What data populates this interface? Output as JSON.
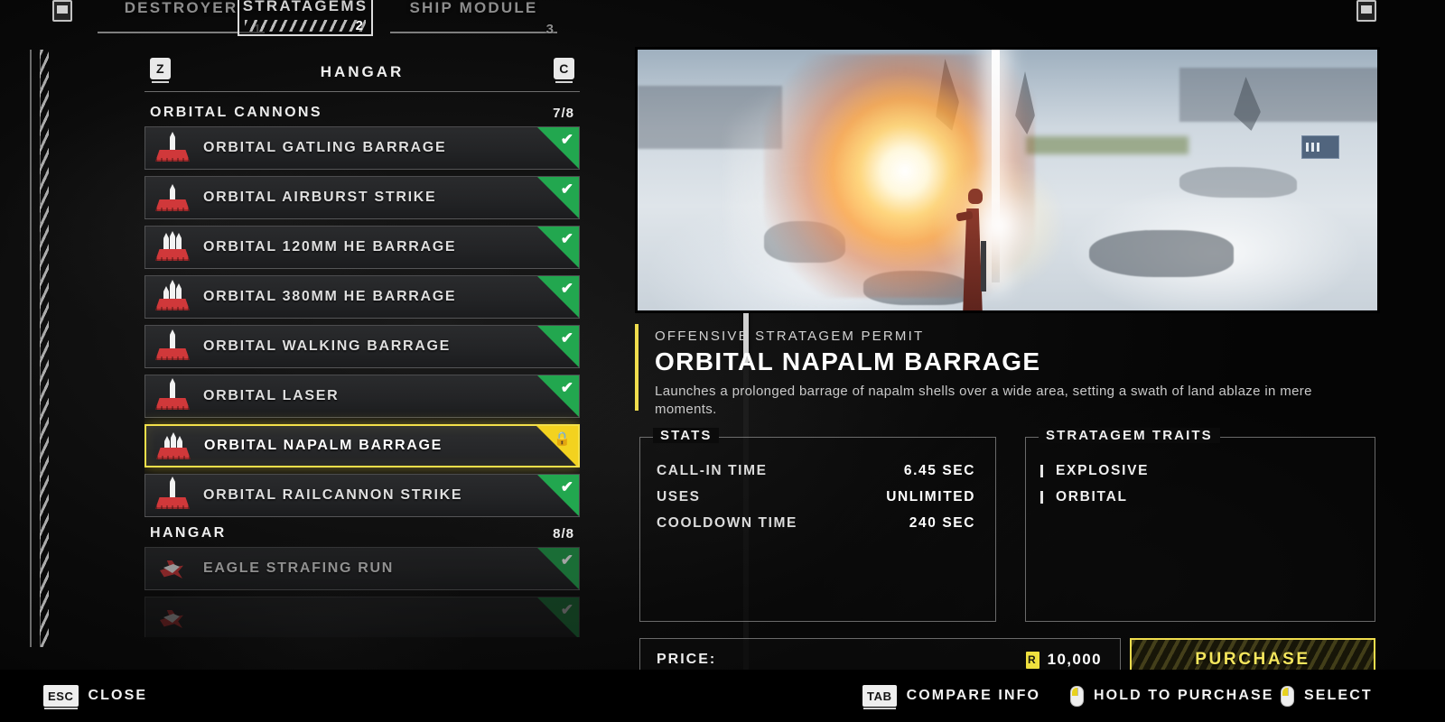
{
  "topbar": {
    "tabs": [
      {
        "label": "DESTROYER",
        "number": "1",
        "active": false
      },
      {
        "label": "STRATAGEMS",
        "number": "2",
        "active": true
      },
      {
        "label": "SHIP MODULE",
        "number": "3",
        "active": false
      }
    ]
  },
  "list": {
    "header_title": "HANGAR",
    "key_left": "Z",
    "key_right": "C",
    "groups": [
      {
        "name": "ORBITAL CANNONS",
        "count": "7/8",
        "items": [
          {
            "label": "ORBITAL GATLING BARRAGE",
            "state": "owned",
            "mark": "✔",
            "icon": "orbital-cannon-icon"
          },
          {
            "label": "ORBITAL AIRBURST STRIKE",
            "state": "owned",
            "mark": "✔",
            "icon": "orbital-cannon-icon"
          },
          {
            "label": "ORBITAL 120MM HE BARRAGE",
            "state": "owned",
            "mark": "✔",
            "icon": "orbital-cannon-icon"
          },
          {
            "label": "ORBITAL 380MM HE BARRAGE",
            "state": "owned",
            "mark": "✔",
            "icon": "orbital-cannon-icon"
          },
          {
            "label": "ORBITAL WALKING BARRAGE",
            "state": "owned",
            "mark": "✔",
            "icon": "orbital-cannon-icon"
          },
          {
            "label": "ORBITAL LASER",
            "state": "owned",
            "mark": "✔",
            "icon": "orbital-cannon-icon"
          },
          {
            "label": "ORBITAL NAPALM BARRAGE",
            "state": "locked-selected",
            "mark": "🔒",
            "icon": "orbital-cannon-icon"
          },
          {
            "label": "ORBITAL RAILCANNON STRIKE",
            "state": "owned",
            "mark": "✔",
            "icon": "orbital-cannon-icon"
          }
        ]
      },
      {
        "name": "HANGAR",
        "count": "8/8",
        "items": [
          {
            "label": "EAGLE STRAFING RUN",
            "state": "owned",
            "mark": "✔",
            "icon": "eagle-icon"
          }
        ]
      }
    ]
  },
  "detail": {
    "category": "OFFENSIVE STRATAGEM PERMIT",
    "name": "ORBITAL NAPALM BARRAGE",
    "description": "Launches a prolonged barrage of napalm shells over a wide area, setting a swath of land ablaze in mere moments.",
    "stats_title": "STATS",
    "stats": [
      {
        "key": "CALL-IN TIME",
        "value": "6.45 SEC"
      },
      {
        "key": "USES",
        "value": "UNLIMITED"
      },
      {
        "key": "COOLDOWN TIME",
        "value": "240 SEC"
      }
    ],
    "traits_title": "STRATAGEM TRAITS",
    "traits": [
      "EXPLOSIVE",
      "ORBITAL"
    ],
    "price_label": "PRICE:",
    "price_value": "10,000",
    "currency_symbol": "R",
    "purchase_label": "PURCHASE"
  },
  "bottombar": {
    "close_key": "ESC",
    "close_label": "CLOSE",
    "compare_key": "TAB",
    "compare_label": "COMPARE INFO",
    "hold_label": "HOLD TO PURCHASE",
    "select_label": "SELECT"
  },
  "colors": {
    "accent_yellow": "#f0dd4d",
    "owned_green": "#22a74f",
    "locked_yellow": "#f3d21f"
  }
}
